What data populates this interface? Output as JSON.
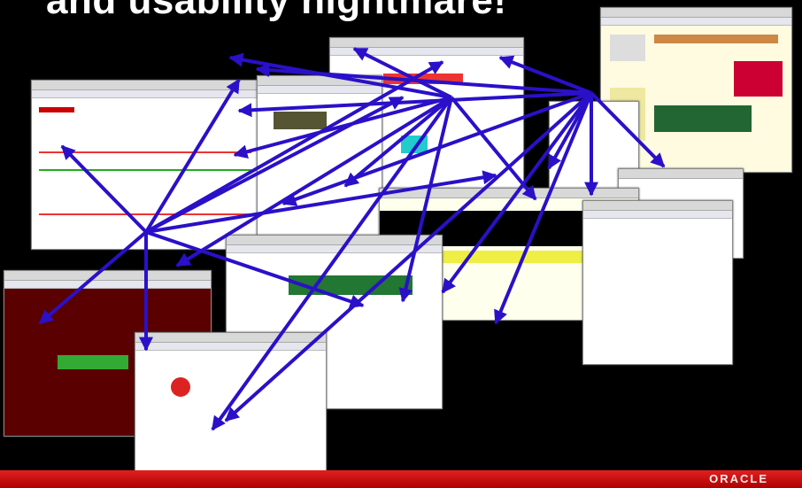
{
  "slide": {
    "title": "and usability nightmare!",
    "logo": "ORACLE"
  },
  "colors": {
    "background": "#000000",
    "arrow": "#2a10c8",
    "footer": "#d01818"
  },
  "screenshots": [
    "page-1",
    "page-2",
    "page-3",
    "page-4",
    "page-5",
    "page-6",
    "page-7",
    "page-8",
    "page-9",
    "page-10",
    "page-11",
    "page-12"
  ]
}
